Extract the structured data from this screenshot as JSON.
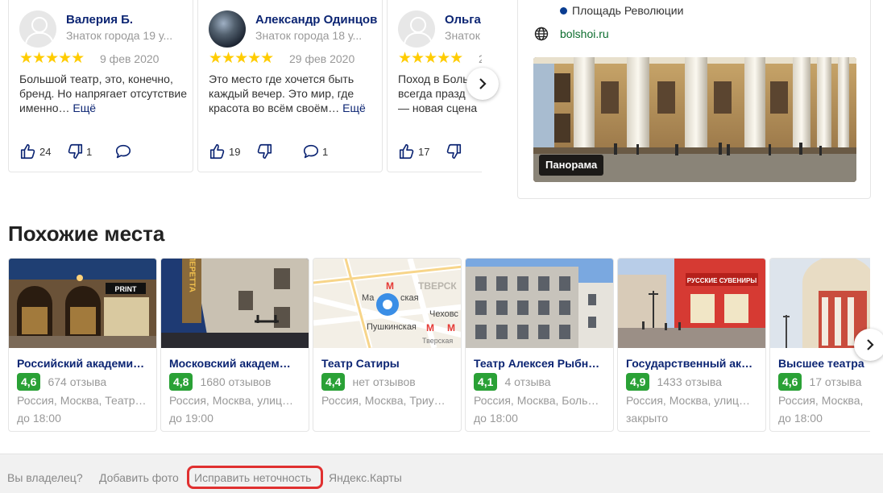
{
  "reviews": [
    {
      "name": "Валерия Б.",
      "subtitle": "Знаток города 19 у...",
      "stars": "★★★★★",
      "date": "9 фев 2020",
      "text": "Большой театр, это, конечно, бренд. Но напрягает отсутствие именно…",
      "more": "Ещё",
      "likes": "24",
      "dislikes": "1",
      "comments": ""
    },
    {
      "name": "Александр Одинцов",
      "subtitle": "Знаток города 18 у...",
      "stars": "★★★★★",
      "date": "29 фев 2020",
      "text": "Это место где хочется быть каждый вечер. Это мир, где красота во всём своём…",
      "more": "Ещё",
      "likes": "19",
      "dislikes": "",
      "comments": "1"
    },
    {
      "name": "Ольга",
      "subtitle": "Знаток г",
      "stars": "★★★★★",
      "date": "2",
      "text": "Поход в Боль всегда празд — новая сцена",
      "more": "",
      "likes": "17",
      "dislikes": "",
      "comments": ""
    }
  ],
  "info": {
    "metro": "Площадь Революции",
    "website": "bolshoi.ru",
    "panorama_label": "Панорама"
  },
  "similar": {
    "title": "Похожие места",
    "places": [
      {
        "name": "Российский академи…",
        "rating": "4,6",
        "reviews": "674 отзыва",
        "address": "Россия, Москва, Театр…",
        "hours": "до 18:00"
      },
      {
        "name": "Московский академ…",
        "rating": "4,8",
        "reviews": "1680 отзывов",
        "address": "Россия, Москва, улиц…",
        "hours": "до 19:00"
      },
      {
        "name": "Театр Сатиры",
        "rating": "4,4",
        "reviews": "нет отзывов",
        "address": "Россия, Москва, Триу…",
        "hours": ""
      },
      {
        "name": "Театр Алексея Рыбн…",
        "rating": "4,1",
        "reviews": "4 отзыва",
        "address": "Россия, Москва, Боль…",
        "hours": "до 18:00"
      },
      {
        "name": "Государственный ак…",
        "rating": "4,9",
        "reviews": "1433 отзыва",
        "address": "Россия, Москва, улиц…",
        "hours": "закрыто"
      },
      {
        "name": "Высшее театра",
        "rating": "4,6",
        "reviews": "17 отзыва",
        "address": "Россия, Москва, ",
        "hours": "до 18:00"
      }
    ],
    "map_labels": {
      "station1": "Ма",
      "station1b": "ская",
      "station2": "Пушкинская",
      "station3": "Чеховс",
      "district": "ТВЕРСК",
      "district2": "Тверская"
    },
    "sign1": "PRINT",
    "sign2": "ОПЕРЕТТА",
    "sign3": "РУССКИЕ СУВЕНИРЫ"
  },
  "footer": {
    "owner": "Вы владелец?",
    "add_photo": "Добавить фото",
    "fix": "Исправить неточность",
    "yandex_maps": "Яндекс.Карты"
  }
}
